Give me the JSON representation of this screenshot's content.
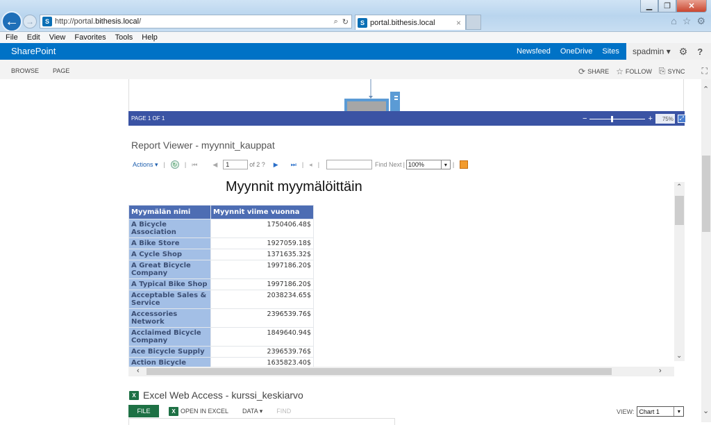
{
  "browser": {
    "url_prefix": "http://portal.",
    "url_domain": "bithesis.local",
    "url_suffix": "/",
    "tab_title": "portal.bithesis.local",
    "tab_close": "×",
    "favicon_label": "S",
    "menu": [
      "File",
      "Edit",
      "View",
      "Favorites",
      "Tools",
      "Help"
    ],
    "window_buttons": {
      "minimize": "▁",
      "maximize": "❐",
      "close": "✕"
    },
    "icons": {
      "back": "←",
      "forward": "→",
      "search": "⌕",
      "refresh": "↻",
      "home": "⌂",
      "favorites": "☆",
      "tools": "⚙"
    }
  },
  "suite": {
    "brand": "SharePoint",
    "links": [
      "Newsfeed",
      "OneDrive",
      "Sites"
    ],
    "user": "spadmin ▾",
    "gear": "⚙",
    "help": "?"
  },
  "ribbon": {
    "tabs": [
      "BROWSE",
      "PAGE"
    ],
    "tools": [
      {
        "icon": "⟳",
        "label": "SHARE"
      },
      {
        "icon": "☆",
        "label": "FOLLOW"
      },
      {
        "icon": "⎘",
        "label": "SYNC"
      }
    ],
    "focus_icon": "⛶"
  },
  "viewer": {
    "page_info": "PAGE 1 OF 1",
    "zoom_minus": "−",
    "zoom_plus": "+",
    "zoom_percent": "75%",
    "zoom_level_fraction": 0.38,
    "fit_icon": "⤢"
  },
  "report_viewer": {
    "title": "Report Viewer - myynnit_kauppat",
    "toolbar": {
      "actions": "Actions ▾",
      "sep": "|",
      "refresh_icon": "↻",
      "first_icon": "⏮",
      "prev_icon": "◀",
      "page_value": "1",
      "of_pages": "of 2 ?",
      "next_icon": "▶",
      "last_icon": "⏭",
      "back_icon": "◂",
      "find_value": "",
      "find_next": "Find Next",
      "zoom_value": "100%",
      "dropdown_icon": "▾"
    },
    "report": {
      "title": "Myynnit myymälöittäin",
      "columns": [
        "Myymälän nimi",
        "Myynnit viime vuonna"
      ],
      "rows": [
        {
          "name": "A Bicycle Association",
          "value": "1750406.48$"
        },
        {
          "name": "A Bike Store",
          "value": "1927059.18$"
        },
        {
          "name": "A Cycle Shop",
          "value": "1371635.32$"
        },
        {
          "name": "A Great Bicycle Company",
          "value": "1997186.20$"
        },
        {
          "name": "A Typical Bike Shop",
          "value": "1997186.20$"
        },
        {
          "name": "Acceptable Sales & Service",
          "value": "2038234.65$"
        },
        {
          "name": "Accessories Network",
          "value": "2396539.76$"
        },
        {
          "name": "Acclaimed Bicycle Company",
          "value": "1849640.94$"
        },
        {
          "name": "Ace Bicycle Supply",
          "value": "2396539.76$"
        },
        {
          "name": "Action Bicycle",
          "value": "1635823.40$"
        }
      ]
    },
    "scroll": {
      "up": "⌃",
      "down": "⌄",
      "left": "‹",
      "right": "›"
    }
  },
  "excel": {
    "icon_label": "X",
    "title": "Excel Web Access - kurssi_keskiarvo",
    "file": "FILE",
    "open_in_excel": "OPEN IN EXCEL",
    "data": "DATA ▾",
    "find": "FIND",
    "view_label": "VIEW:",
    "view_value": "Chart 1",
    "dropdown_icon": "▾"
  },
  "page_scroll": {
    "up": "⌃",
    "down": "⌄"
  }
}
